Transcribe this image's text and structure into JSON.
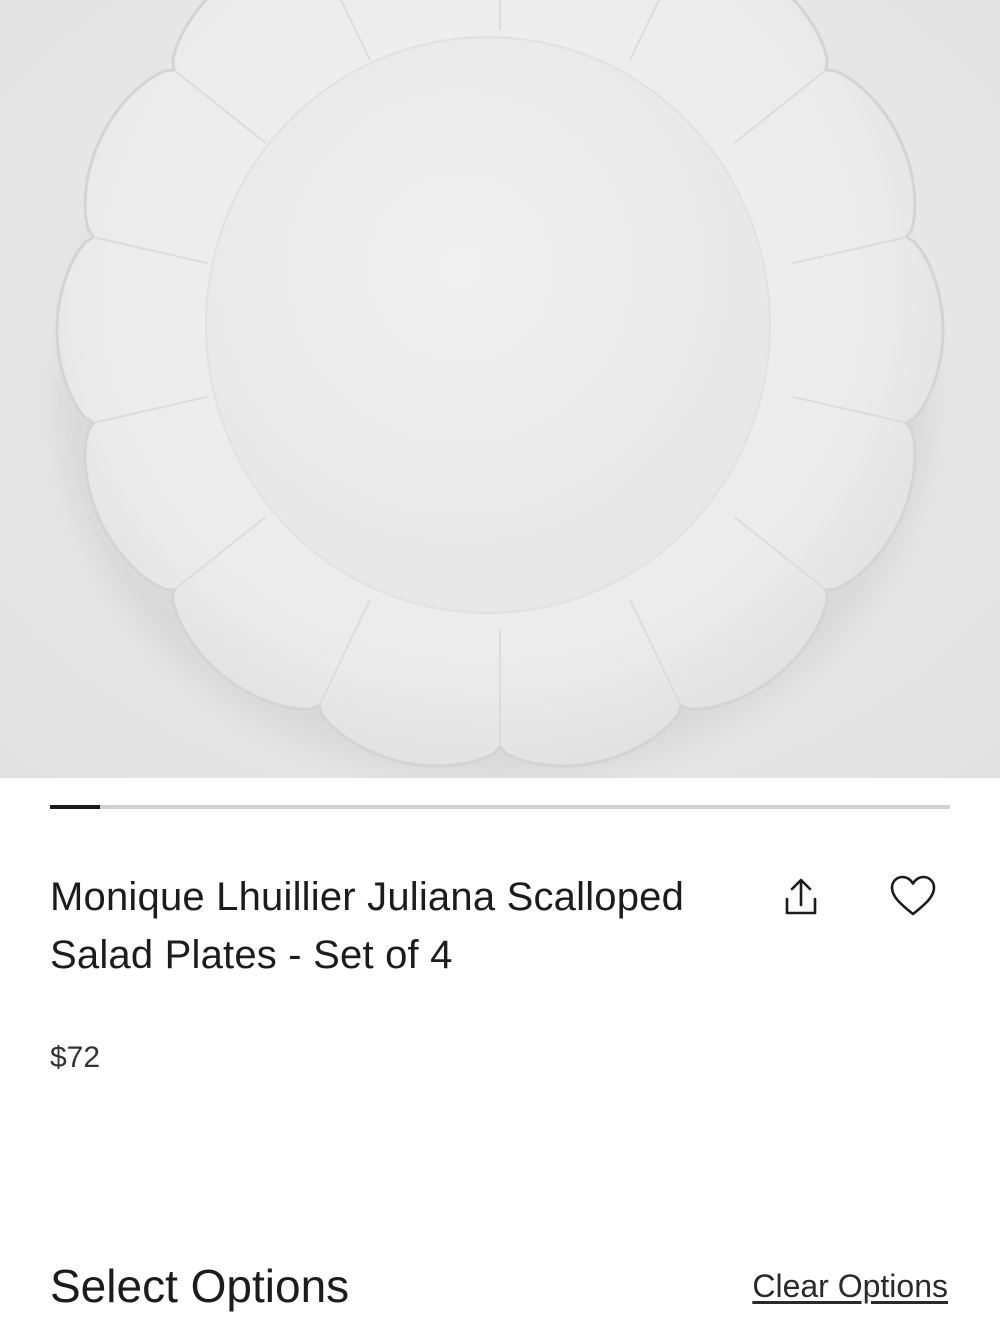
{
  "product": {
    "image_alt": "Monique Lhuillier Juliana Scalloped Salad Plate",
    "title": "Monique Lhuillier Juliana Scalloped Salad Plates - Set of 4",
    "price": "$72"
  },
  "carousel": {
    "current_slide_fraction": 0.055
  },
  "actions": {
    "share_icon": "share-icon",
    "wishlist_icon": "heart-icon"
  },
  "options": {
    "heading": "Select Options",
    "clear_label": "Clear Options"
  },
  "colors": {
    "accent_text": "#1c1c1c",
    "track": "#d3d1ca",
    "thumb": "#1a1a1a"
  }
}
